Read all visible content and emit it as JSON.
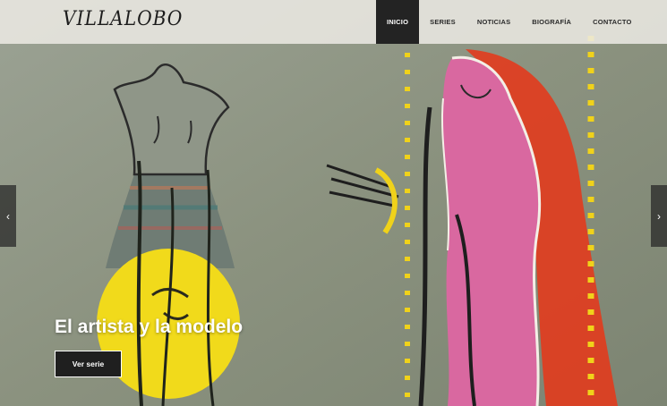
{
  "brand": {
    "logo_text": "VILLALOBO"
  },
  "nav": {
    "items": [
      {
        "label": "INICIO",
        "active": true
      },
      {
        "label": "SERIES",
        "active": false
      },
      {
        "label": "NOTICIAS",
        "active": false
      },
      {
        "label": "BIOGRAFÍA",
        "active": false
      },
      {
        "label": "CONTACTO",
        "active": false
      }
    ]
  },
  "slider": {
    "caption": "El artista y la modelo",
    "cta_label": "Ver serie",
    "prev_icon": "chevron-left-icon",
    "next_icon": "chevron-right-icon"
  },
  "colors": {
    "canvas_bg": "#8c9484",
    "nav_active_bg": "#232323",
    "painting_yellow": "#f2dc1c",
    "painting_pink": "#df6a9e",
    "painting_red": "#e03a1e"
  }
}
